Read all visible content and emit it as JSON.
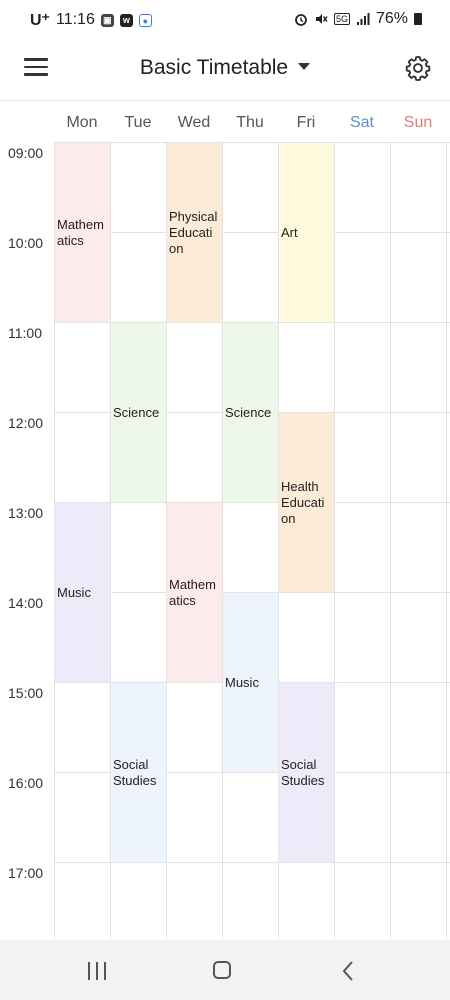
{
  "status_bar": {
    "carrier": "U⁺",
    "time": "11:16",
    "network": "5G",
    "battery": "76%",
    "left_icons": [
      "gallery-icon",
      "w-app-icon",
      "location-app-icon"
    ],
    "right_icons": [
      "alarm-icon",
      "mute-icon",
      "signal-icon",
      "battery-icon"
    ]
  },
  "app_bar": {
    "title": "Basic Timetable",
    "menu_icon": "hamburger-menu-icon",
    "dropdown_icon": "caret-down-icon",
    "settings_icon": "gear-icon"
  },
  "colors": {
    "weekday": "#555555",
    "saturday": "#5b8fc7",
    "sunday": "#e07b74",
    "pink": "#fdeaea",
    "orange": "#fcebd6",
    "yellow": "#fdfbdc",
    "green": "#edf8ea",
    "purple": "#efeaf9",
    "blue": "#eef4fc"
  },
  "timetable": {
    "days": [
      "Mon",
      "Tue",
      "Wed",
      "Thu",
      "Fri",
      "Sat",
      "Sun"
    ],
    "times": [
      "09:00",
      "10:00",
      "11:00",
      "12:00",
      "13:00",
      "14:00",
      "15:00",
      "16:00",
      "17:00"
    ],
    "classes": [
      {
        "name": "Mathematics",
        "label_lines": [
          "Mathem",
          "atics"
        ],
        "day": "Mon",
        "start": "09:00",
        "end": "11:00",
        "color": "pink"
      },
      {
        "name": "Physical Education",
        "label_lines": [
          "Physical",
          "Educati",
          "on"
        ],
        "day": "Wed",
        "start": "09:00",
        "end": "11:00",
        "color": "orange"
      },
      {
        "name": "Art",
        "label_lines": [
          "Art"
        ],
        "day": "Fri",
        "start": "09:00",
        "end": "11:00",
        "color": "yellow"
      },
      {
        "name": "Science",
        "label_lines": [
          "Science"
        ],
        "day": "Tue",
        "start": "11:00",
        "end": "13:00",
        "color": "green"
      },
      {
        "name": "Science",
        "label_lines": [
          "Science"
        ],
        "day": "Thu",
        "start": "11:00",
        "end": "13:00",
        "color": "green"
      },
      {
        "name": "Health Education",
        "label_lines": [
          "Health",
          "Educati",
          "on"
        ],
        "day": "Fri",
        "start": "12:00",
        "end": "14:00",
        "color": "orange"
      },
      {
        "name": "Music",
        "label_lines": [
          "Music"
        ],
        "day": "Mon",
        "start": "13:00",
        "end": "15:00",
        "color": "purple"
      },
      {
        "name": "Mathematics",
        "label_lines": [
          "Mathem",
          "atics"
        ],
        "day": "Wed",
        "start": "13:00",
        "end": "15:00",
        "color": "pink"
      },
      {
        "name": "Music",
        "label_lines": [
          "Music"
        ],
        "day": "Thu",
        "start": "14:00",
        "end": "16:00",
        "color": "blue"
      },
      {
        "name": "Social Studies",
        "label_lines": [
          "Social",
          "Studies"
        ],
        "day": "Tue",
        "start": "15:00",
        "end": "17:00",
        "color": "blue"
      },
      {
        "name": "Social Studies",
        "label_lines": [
          "Social",
          "Studies"
        ],
        "day": "Fri",
        "start": "15:00",
        "end": "17:00",
        "color": "purple"
      }
    ]
  },
  "nav_bar": {
    "icons": [
      "recent-apps-icon",
      "home-icon",
      "back-icon"
    ]
  }
}
